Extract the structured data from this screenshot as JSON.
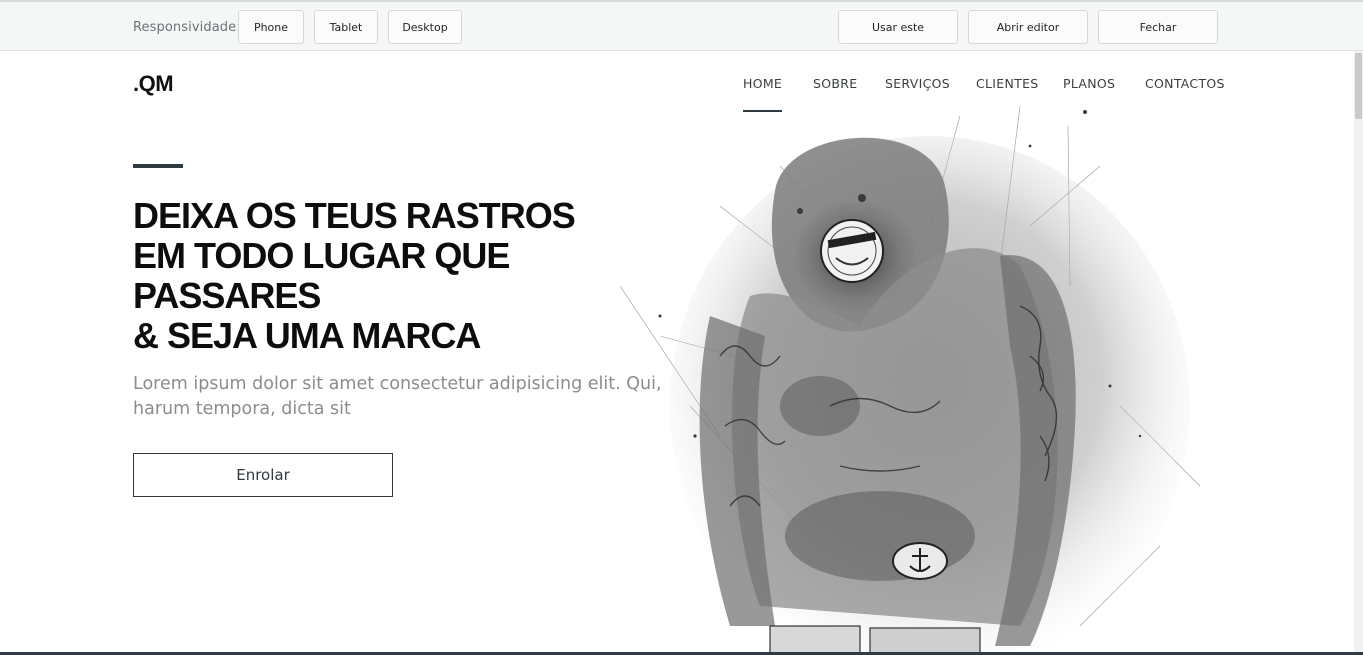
{
  "toolbar": {
    "responsive_label": "Responsividade:",
    "phone": "Phone",
    "tablet": "Tablet",
    "desktop": "Desktop",
    "use_this": "Usar este",
    "open_editor": "Abrir editor",
    "close": "Fechar"
  },
  "site": {
    "logo": ".QM",
    "nav": [
      "HOME",
      "SOBRE",
      "SERVIÇOS",
      "CLIENTES",
      "PLANOS",
      "CONTACTOS"
    ],
    "active_nav": "HOME",
    "headline": [
      "DEIXA OS TEUS RASTROS",
      "EM TODO LUGAR QUE",
      "PASSARES",
      "& SEJA UMA MARCA"
    ],
    "lead": "Lorem ipsum dolor sit amet consectetur adipisicing elit. Qui, harum tempora, dicta sit",
    "cta": "Enrolar",
    "hero_image": "tattooed-man-sketch-illustration"
  },
  "colors": {
    "accent": "#2e3a40",
    "toolbar_bg": "#f5f6f6",
    "lead_text": "#8a8d90"
  }
}
